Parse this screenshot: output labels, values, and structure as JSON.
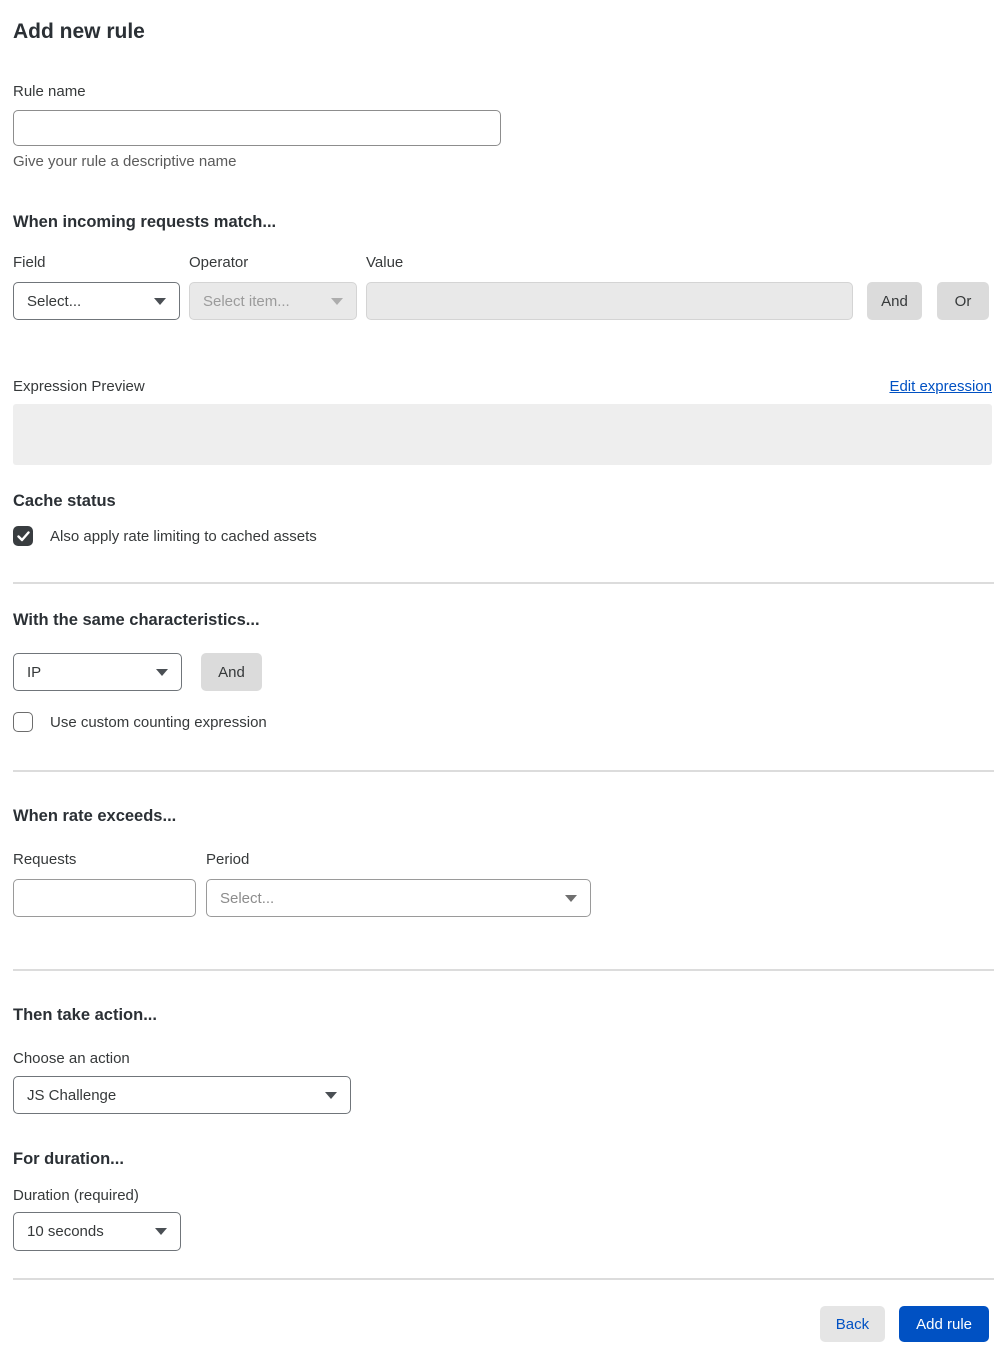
{
  "page": {
    "title": "Add new rule"
  },
  "rule_name": {
    "label": "Rule name",
    "value": "",
    "help": "Give your rule a descriptive name"
  },
  "match_section": {
    "heading": "When incoming requests match...",
    "field": {
      "label": "Field",
      "selected": "Select..."
    },
    "operator": {
      "label": "Operator",
      "selected": "Select item...",
      "disabled": true
    },
    "value": {
      "label": "Value",
      "value": "",
      "disabled": true
    },
    "and_button": "And",
    "or_button": "Or",
    "expression_preview_label": "Expression Preview",
    "edit_expression_link": "Edit expression",
    "expression_value": ""
  },
  "cache_status": {
    "heading": "Cache status",
    "checkbox_label": "Also apply rate limiting to cached assets",
    "checked": true
  },
  "characteristics": {
    "heading": "With the same characteristics...",
    "select_value": "IP",
    "and_button": "And",
    "checkbox_label": "Use custom counting expression",
    "checked": false
  },
  "rate_section": {
    "heading": "When rate exceeds...",
    "requests": {
      "label": "Requests",
      "value": ""
    },
    "period": {
      "label": "Period",
      "placeholder": "Select..."
    }
  },
  "action_section": {
    "heading": "Then take action...",
    "label": "Choose an action",
    "selected": "JS Challenge"
  },
  "duration_section": {
    "heading": "For duration...",
    "label": "Duration (required)",
    "selected": "10 seconds"
  },
  "footer": {
    "back_button": "Back",
    "add_rule_button": "Add rule"
  },
  "colors": {
    "accent_blue": "#0051c3",
    "text_dark": "#36393a",
    "disabled_bg": "#e9e9e9",
    "divider": "#dcdcdc",
    "checked_checkbox": "#393d40"
  }
}
